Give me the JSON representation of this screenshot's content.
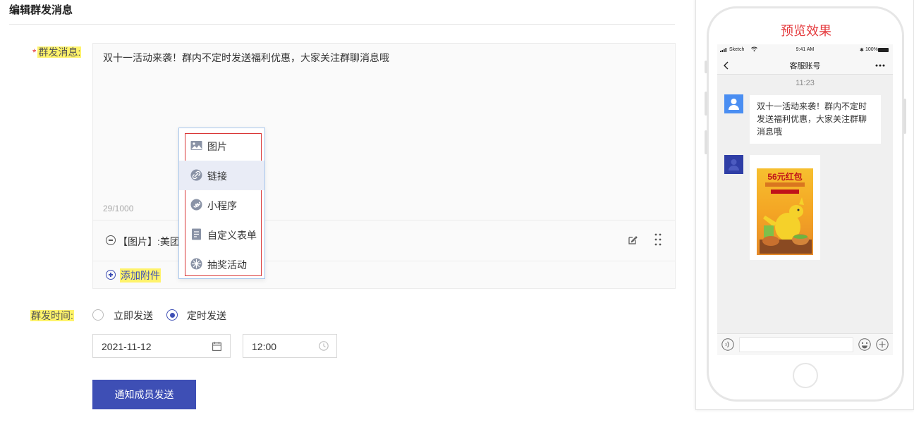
{
  "page": {
    "title": "编辑群发消息"
  },
  "message": {
    "label": "群发消息:",
    "required_mark": "*",
    "text": "双十一活动来袭！群内不定时发送福利优惠，大家关注群聊消息哦",
    "count": "29/1000"
  },
  "attachment": {
    "text": "【图片】:美团",
    "edit_icon": "edit-icon",
    "drag_icon": "drag-handle-icon"
  },
  "add_attachment": {
    "label": "添加附件"
  },
  "attach_menu": {
    "items": [
      {
        "label": "图片",
        "icon": "image-icon"
      },
      {
        "label": "链接",
        "icon": "link-icon",
        "active": true
      },
      {
        "label": "小程序",
        "icon": "mini-program-icon"
      },
      {
        "label": "自定义表单",
        "icon": "form-icon"
      },
      {
        "label": "抽奖活动",
        "icon": "lottery-icon"
      }
    ]
  },
  "send_time": {
    "label": "群发时间:",
    "options": [
      {
        "label": "立即发送",
        "checked": false
      },
      {
        "label": "定时发送",
        "checked": true
      }
    ],
    "date": "2021-11-12",
    "time": "12:00"
  },
  "submit": {
    "label": "通知成员发送"
  },
  "preview": {
    "title": "预览效果",
    "status": {
      "carrier": "Sketch",
      "time": "9:41 AM",
      "battery": "100%"
    },
    "nav_title": "客服账号",
    "chat_time": "11:23",
    "bubble_text": "双十一活动来袭！群内不定时发送福利优惠，大家关注群聊消息哦",
    "poster_headline": "56元红包"
  },
  "colors": {
    "accent": "#3e4fb5",
    "highlight": "#fff36b",
    "danger": "#e4393c"
  }
}
